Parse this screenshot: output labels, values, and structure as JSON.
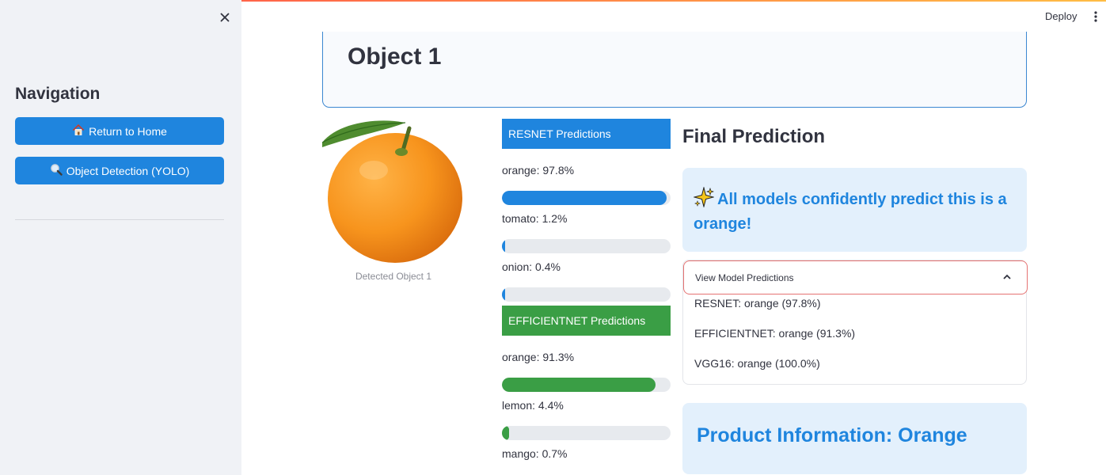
{
  "sidebar": {
    "title": "Navigation",
    "buttons": [
      {
        "label": "Return to Home",
        "icon": "home-icon"
      },
      {
        "label": "Object Detection (YOLO)",
        "icon": "magnifier-icon"
      }
    ]
  },
  "header": {
    "deploy_label": "Deploy"
  },
  "object": {
    "title": "Object 1",
    "image_caption": "Detected Object 1"
  },
  "resnet": {
    "heading": "RESNET Predictions",
    "color": "#1f85de",
    "predictions": [
      {
        "label": "orange: 97.8%",
        "value": 0.978
      },
      {
        "label": "tomato: 1.2%",
        "value": 0.012
      },
      {
        "label": "onion: 0.4%",
        "value": 0.004
      }
    ]
  },
  "efficientnet": {
    "heading": "EFFICIENTNET Predictions",
    "color": "#3a9e45",
    "predictions": [
      {
        "label": "orange: 91.3%",
        "value": 0.913
      },
      {
        "label": "lemon: 4.4%",
        "value": 0.044
      },
      {
        "label": "mango: 0.7%",
        "value": null
      }
    ]
  },
  "final": {
    "title": "Final Prediction",
    "message": "All models confidently predict this is a orange!",
    "expander_label": "View Model Predictions",
    "model_results": [
      "RESNET: orange (97.8%)",
      "EFFICIENTNET: orange (91.3%)",
      "VGG16: orange (100.0%)"
    ],
    "product_title": "Product Information: Orange"
  }
}
